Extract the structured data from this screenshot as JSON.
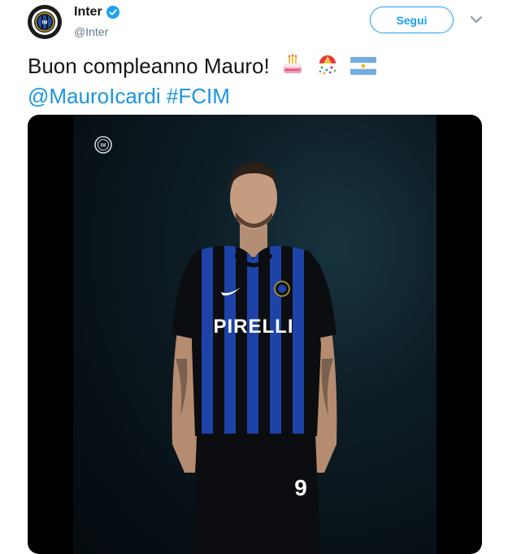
{
  "account": {
    "name": "Inter",
    "handle": "@Inter",
    "verified": true,
    "avatar_icon": "inter-logo-icon"
  },
  "actions": {
    "follow_label": "Segui",
    "menu_icon": "chevron-down-icon"
  },
  "tweet": {
    "text": "Buon compleanno Mauro!",
    "emojis": [
      "birthday-cake-icon",
      "confetti-ball-icon",
      "argentina-flag-icon"
    ],
    "mention": "@MauroIcardi",
    "hashtag": "#FCIM"
  },
  "media": {
    "logo_icon": "inter-logo-icon",
    "subject_icon": "player-photo",
    "sponsor_text": "PIRELLI",
    "shirt_number": "9"
  },
  "colors": {
    "link": "#1b95e0",
    "button": "#1da1f2",
    "shirt_blue": "#1e43a8",
    "shirt_black": "#0b0d10"
  }
}
